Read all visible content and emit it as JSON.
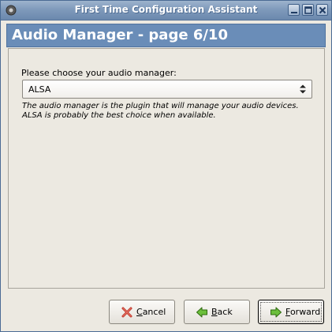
{
  "window": {
    "title": "First Time Configuration Assistant"
  },
  "banner": {
    "title": "Audio Manager - page 6/10"
  },
  "form": {
    "prompt": "Please choose your audio manager:",
    "selected_value": "ALSA",
    "hint": "The audio manager is the plugin that will manage your audio devices. ALSA is probably the best choice when available."
  },
  "buttons": {
    "cancel": {
      "mnemonic": "C",
      "rest": "ancel"
    },
    "back": {
      "mnemonic": "B",
      "rest": "ack"
    },
    "forward": {
      "mnemonic": "F",
      "rest": "orward"
    }
  },
  "colors": {
    "titlebar": "#7f9abb",
    "banner": "#6a8db8",
    "background": "#ece9e1",
    "cancel_icon": "#c0392b",
    "arrow_icon": "#4e9a06"
  },
  "icons": {
    "app": "app-icon",
    "minimize": "minimize-icon",
    "maximize": "maximize-icon",
    "close": "close-icon",
    "cancel": "cancel-x-icon",
    "back": "back-arrow-icon",
    "forward": "forward-arrow-icon",
    "dropdown": "dropdown-arrows-icon"
  }
}
